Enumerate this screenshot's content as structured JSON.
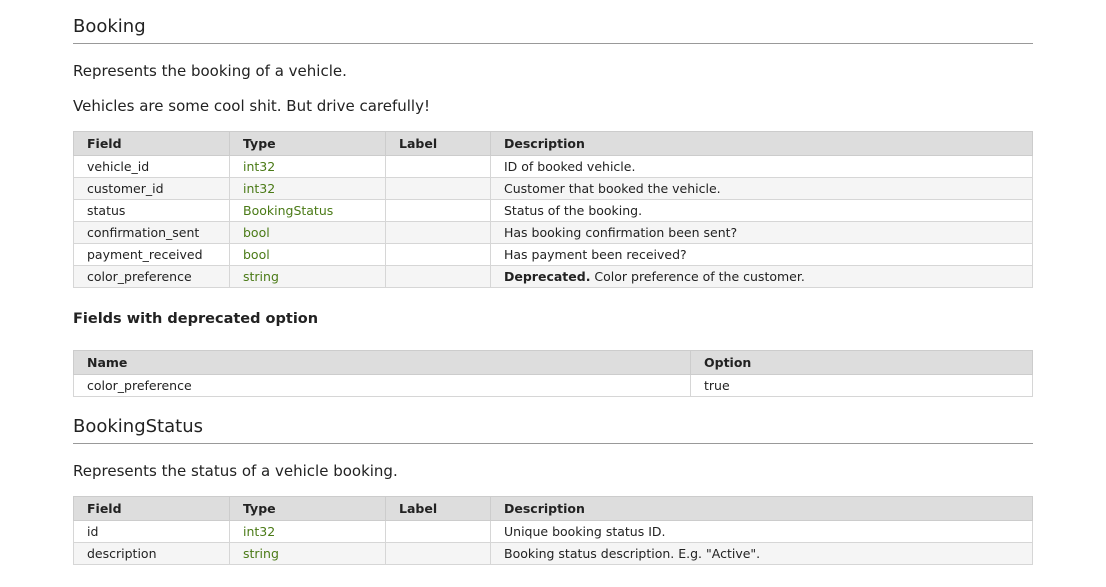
{
  "booking": {
    "title": "Booking",
    "description_1": "Represents the booking of a vehicle.",
    "description_2": "Vehicles are some cool shit. But drive carefully!",
    "headers": [
      "Field",
      "Type",
      "Label",
      "Description"
    ],
    "rows": [
      {
        "field": "vehicle_id",
        "type": "int32",
        "label": "",
        "desc_prefix": "",
        "description": "ID of booked vehicle."
      },
      {
        "field": "customer_id",
        "type": "int32",
        "label": "",
        "desc_prefix": "",
        "description": "Customer that booked the vehicle."
      },
      {
        "field": "status",
        "type": "BookingStatus",
        "label": "",
        "desc_prefix": "",
        "description": "Status of the booking."
      },
      {
        "field": "confirmation_sent",
        "type": "bool",
        "label": "",
        "desc_prefix": "",
        "description": "Has booking confirmation been sent?"
      },
      {
        "field": "payment_received",
        "type": "bool",
        "label": "",
        "desc_prefix": "",
        "description": "Has payment been received?"
      },
      {
        "field": "color_preference",
        "type": "string",
        "label": "",
        "desc_prefix": "Deprecated.",
        "description": " Color preference of the customer."
      }
    ],
    "deprecated": {
      "heading": "Fields with deprecated option",
      "headers": [
        "Name",
        "Option"
      ],
      "rows": [
        {
          "name": "color_preference",
          "option": "true"
        }
      ]
    }
  },
  "booking_status": {
    "title": "BookingStatus",
    "description": "Represents the status of a vehicle booking.",
    "headers": [
      "Field",
      "Type",
      "Label",
      "Description"
    ],
    "rows": [
      {
        "field": "id",
        "type": "int32",
        "label": "",
        "description": "Unique booking status ID."
      },
      {
        "field": "description",
        "type": "string",
        "label": "",
        "description": "Booking status description. E.g. \"Active\"."
      }
    ]
  },
  "colors": {
    "type_text": "#4a7a16",
    "header_bg": "#dddddd",
    "row_alt_bg": "#f5f5f5"
  }
}
